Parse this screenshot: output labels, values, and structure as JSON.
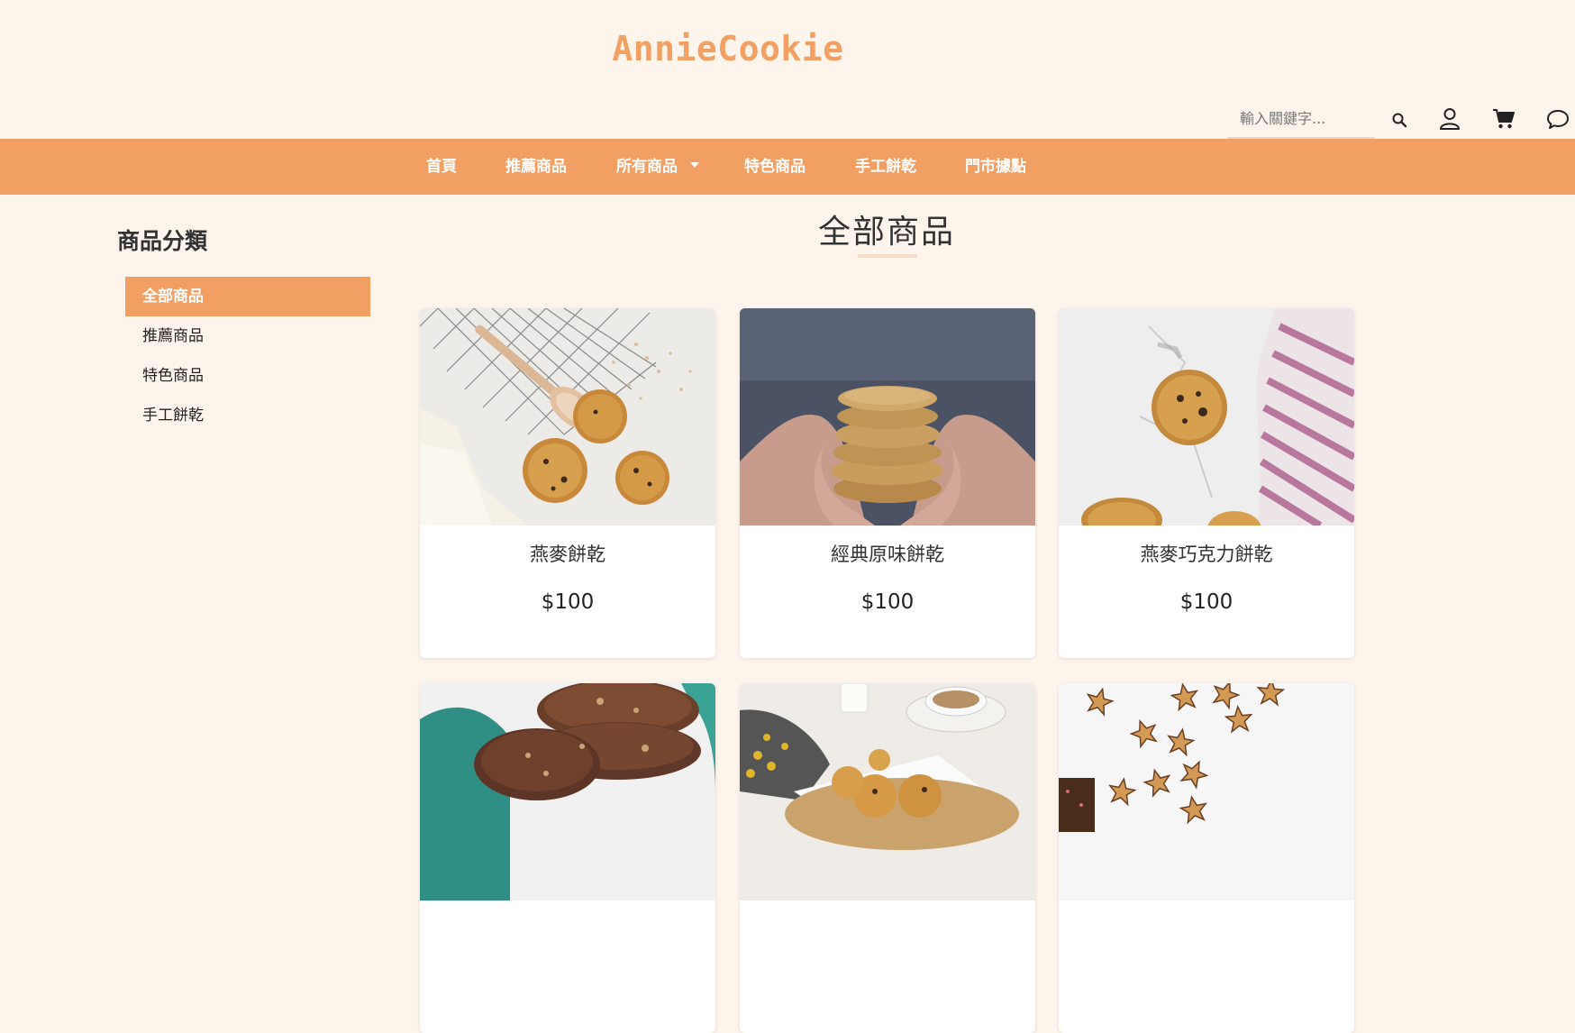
{
  "brand": {
    "logo_text": "AnnieCookie",
    "accent": "#f29f63",
    "logo_color": "#f2a064",
    "page_bg": "#fdf5ec"
  },
  "search": {
    "placeholder": "輸入關鍵字..."
  },
  "header_icons": [
    "search-icon",
    "user-icon",
    "cart-icon",
    "chat-icon"
  ],
  "nav": {
    "items": [
      {
        "label": "首頁"
      },
      {
        "label": "推薦商品"
      },
      {
        "label": "所有商品",
        "dropdown": true
      },
      {
        "label": "特色商品"
      },
      {
        "label": "手工餅乾"
      },
      {
        "label": "門市據點"
      }
    ]
  },
  "sidebar": {
    "title": "商品分類",
    "items": [
      {
        "label": "全部商品",
        "active": true
      },
      {
        "label": "推薦商品"
      },
      {
        "label": "特色商品"
      },
      {
        "label": "手工餅乾"
      }
    ]
  },
  "main": {
    "title": "全部商品",
    "products": [
      {
        "name": "燕麥餅乾",
        "price": "$100"
      },
      {
        "name": "經典原味餅乾",
        "price": "$100"
      },
      {
        "name": "燕麥巧克力餅乾",
        "price": "$100"
      },
      {
        "name": "",
        "price": ""
      },
      {
        "name": "",
        "price": ""
      },
      {
        "name": "",
        "price": ""
      }
    ]
  }
}
